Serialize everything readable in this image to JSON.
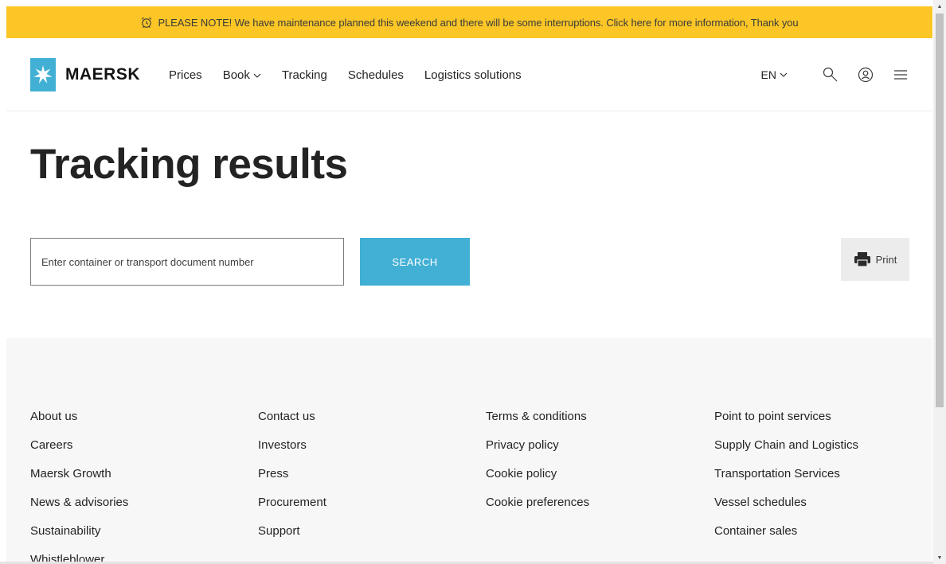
{
  "notice": {
    "text": "PLEASE NOTE! We have maintenance planned this weekend and there will be some interruptions. Click here for more information, Thank you",
    "icon": "alarm-clock-icon",
    "background": "#fbc626"
  },
  "header": {
    "brand": "MAERSK",
    "brand_color": "#42b0d5",
    "nav": [
      {
        "label": "Prices"
      },
      {
        "label": "Book"
      },
      {
        "label": "Tracking"
      },
      {
        "label": "Schedules"
      },
      {
        "label": "Logistics solutions"
      }
    ],
    "language": "EN",
    "icons": [
      "search-icon",
      "user-icon",
      "menu-icon"
    ]
  },
  "main": {
    "title": "Tracking results",
    "search": {
      "placeholder": "Enter container or transport document number",
      "value": "",
      "button_label": "SEARCH"
    },
    "print_label": "Print"
  },
  "footer": {
    "columns": [
      [
        "About us",
        "Careers",
        "Maersk Growth",
        "News & advisories",
        "Sustainability",
        "Whistleblower"
      ],
      [
        "Contact us",
        "Investors",
        "Press",
        "Procurement",
        "Support"
      ],
      [
        "Terms & conditions",
        "Privacy policy",
        "Cookie policy",
        "Cookie preferences"
      ],
      [
        "Point to point services",
        "Supply Chain and Logistics",
        "Transportation Services",
        "Vessel schedules",
        "Container sales"
      ]
    ]
  }
}
